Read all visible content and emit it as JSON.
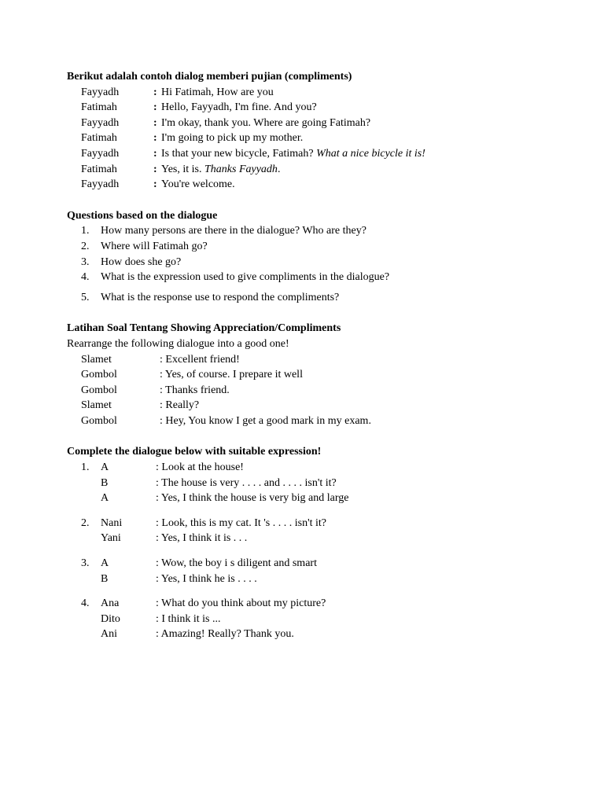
{
  "section1": {
    "title": "Berikut adalah contoh dialog memberi pujian (compliments)",
    "dialogue": [
      {
        "speaker": "Fayyadh",
        "text": "Hi Fatimah, How are you"
      },
      {
        "speaker": "Fatimah",
        "text": "Hello, Fayyadh, I'm fine. And you?"
      },
      {
        "speaker": "Fayyadh",
        "text": "I'm okay, thank you. Where are going Fatimah?"
      },
      {
        "speaker": "Fatimah",
        "text": "I'm going to pick up my mother."
      },
      {
        "speaker": "Fayyadh",
        "text": "Is that your new bicycle, Fatimah? ",
        "italic": "What a nice bicycle it is!"
      },
      {
        "speaker": "Fatimah",
        "text": "Yes, it is. ",
        "italic": "Thanks Fayyadh",
        "suffix": "."
      },
      {
        "speaker": "Fayyadh",
        "text": "You're welcome."
      }
    ]
  },
  "section2": {
    "title": "Questions based on the dialogue",
    "questions": [
      "How many persons are there in the dialogue? Who are they?",
      "Where will Fatimah go?",
      "How does she go?",
      "What is the expression used to give compliments in the dialogue?",
      "What is the response use to respond the compliments?"
    ]
  },
  "section3": {
    "title": "Latihan Soal Tentang Showing Appreciation/Compliments",
    "subtitle": "Rearrange the following dialogue into a good one!",
    "dialogue": [
      {
        "speaker": "Slamet",
        "text": ": Excellent friend!"
      },
      {
        "speaker": "Gombol",
        "text": ": Yes, of course. I prepare it well"
      },
      {
        "speaker": "Gombol",
        "text": ": Thanks friend."
      },
      {
        "speaker": "Slamet",
        "text": ": Really?"
      },
      {
        "speaker": "Gombol",
        "text": ": Hey, You know I get a good mark in my exam."
      }
    ]
  },
  "section4": {
    "title": "Complete the dialogue below with suitable expression!",
    "items": [
      {
        "num": "1.",
        "lines": [
          {
            "speaker": "A",
            "text": ": Look at the house!"
          },
          {
            "speaker": "B",
            "text": ": The house is very . . . . and  . . . . isn't it?"
          },
          {
            "speaker": "A",
            "text": ": Yes, I think the house is very big and large"
          }
        ]
      },
      {
        "num": "2.",
        "lines": [
          {
            "speaker": "Nani",
            "text": ": Look,  this is  my cat. It 's  . . . . isn't it?"
          },
          {
            "speaker": "Yani",
            "text": ": Yes, I think it is . . ."
          }
        ]
      },
      {
        "num": "3.",
        "lines": [
          {
            "speaker": "A",
            "text": ": Wow,  the boy i s diligent and smart"
          },
          {
            "speaker": "B",
            "text": ": Yes, I think he is . . . ."
          }
        ]
      },
      {
        "num": "4.",
        "lines": [
          {
            "speaker": "Ana",
            "text": ": What do you think about my picture?"
          },
          {
            "speaker": "Dito",
            "text": ": I think it is ..."
          },
          {
            "speaker": "Ani",
            "text": ": Amazing! Really? Thank you."
          }
        ]
      }
    ]
  }
}
